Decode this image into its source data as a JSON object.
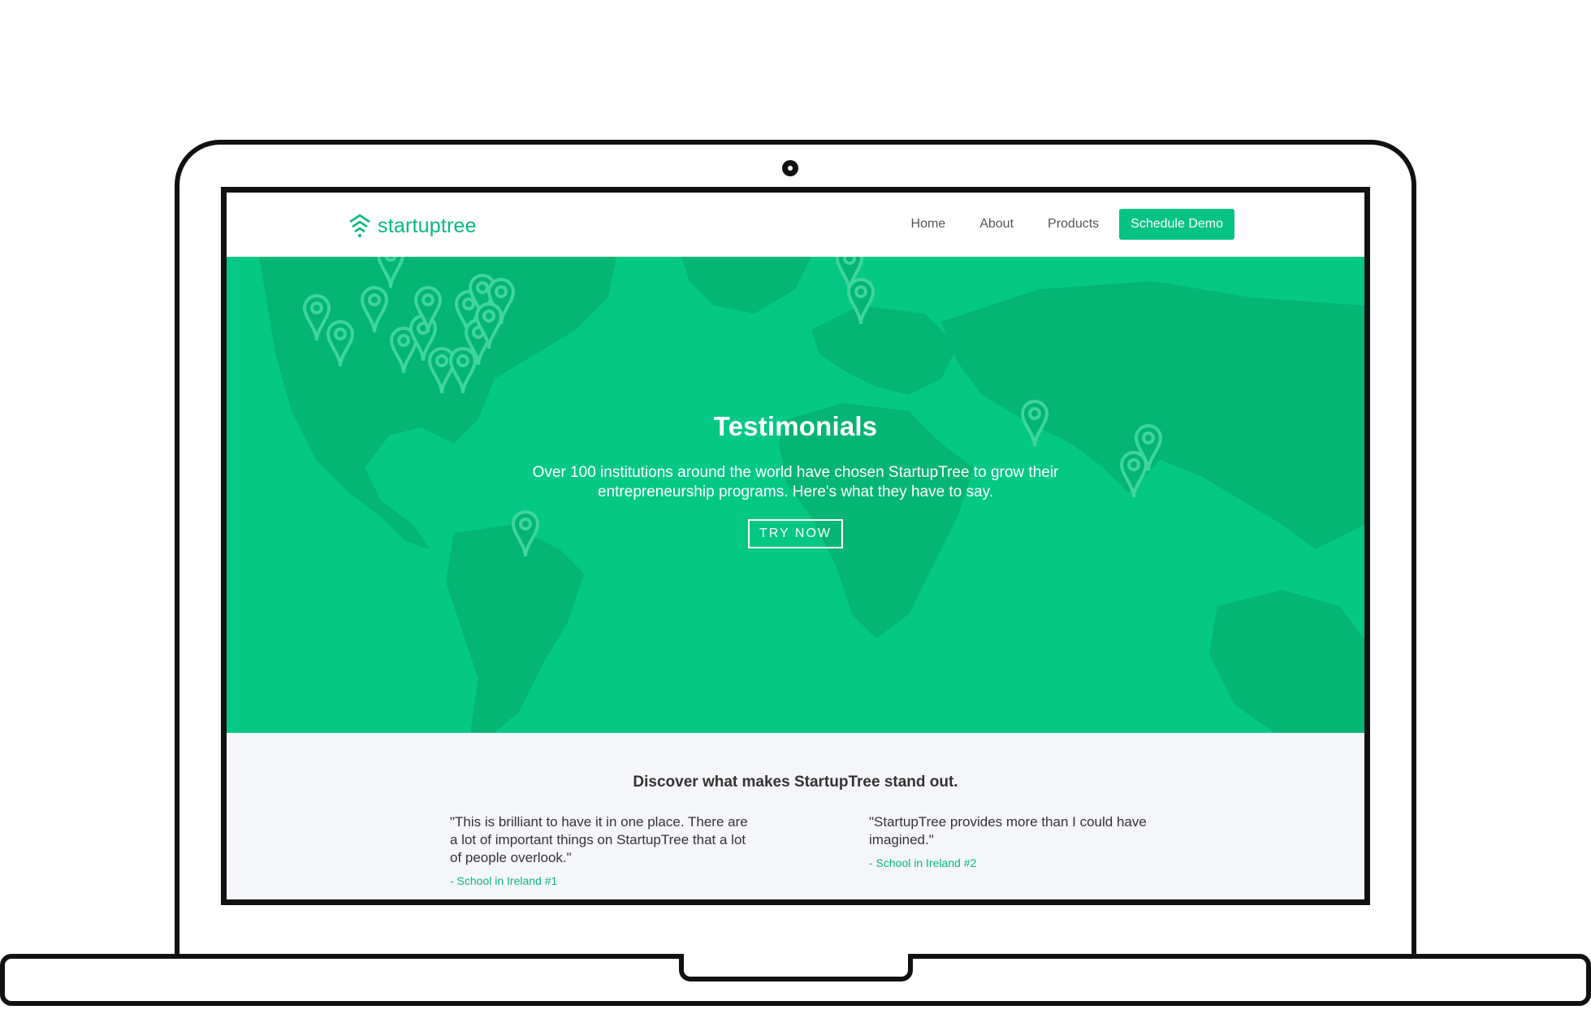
{
  "nav": {
    "logo_text": "startuptree",
    "links": [
      "Home",
      "About",
      "Products"
    ],
    "cta": "Schedule Demo"
  },
  "hero": {
    "title": "Testimonials",
    "subtitle": "Over 100 institutions around the world have chosen StartupTree to grow their entrepreneurship programs. Here's what they have to say.",
    "button": "TRY  NOW"
  },
  "testimonials": {
    "heading": "Discover what makes StartupTree stand out.",
    "items": [
      {
        "quote": "\"This is brilliant to have it in one place. There are a lot of important things on StartupTree that a lot of people overlook.\"",
        "author": "- School in Ireland #1"
      },
      {
        "quote": "\"StartupTree provides more than I could have imagined.\"",
        "author": "- School in Ireland #2"
      }
    ]
  },
  "colors": {
    "brand_green": "#05c884",
    "map_land": "#04b574",
    "section_bg": "#f4f6f9"
  },
  "icons": [
    "startuptree-logo-icon",
    "map-pin-icon",
    "webcam-icon"
  ]
}
